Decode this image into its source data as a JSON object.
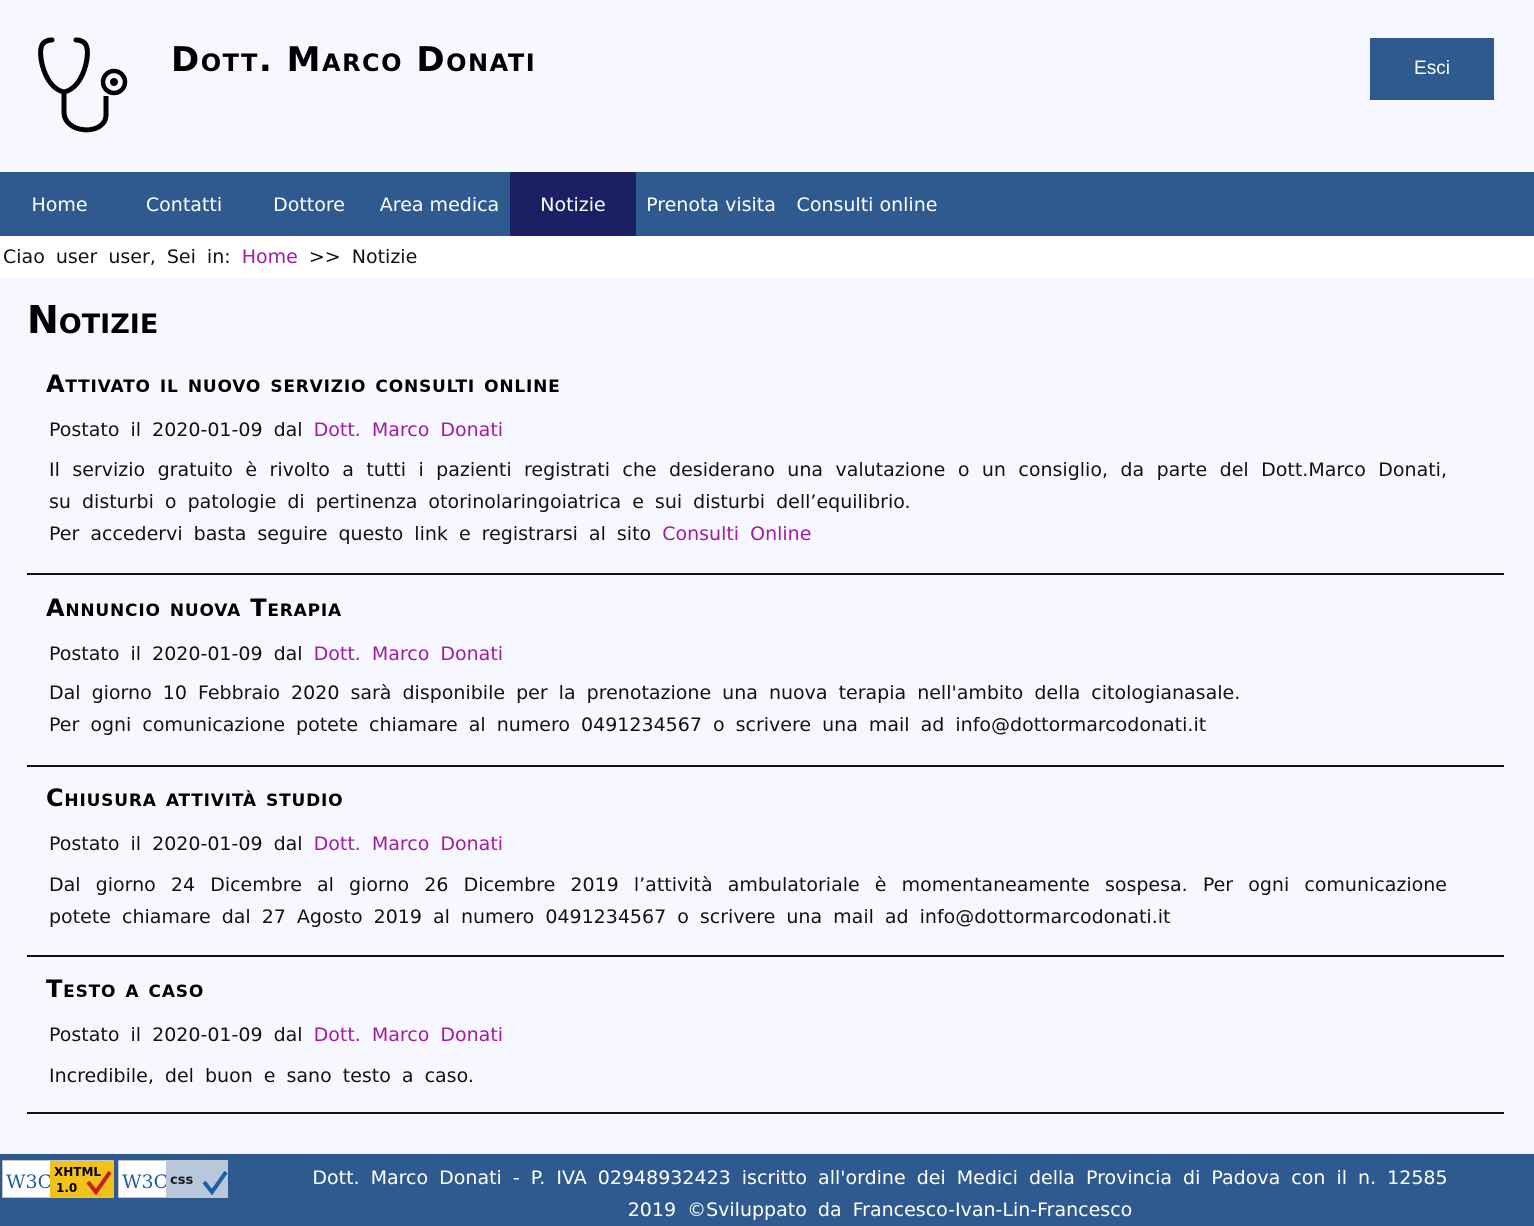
{
  "header": {
    "title": "Dott. Marco Donati",
    "logo_icon": "stethoscope-icon",
    "logout_label": "Esci"
  },
  "nav": {
    "items": [
      {
        "label": "Home"
      },
      {
        "label": "Contatti"
      },
      {
        "label": "Dottore"
      },
      {
        "label": "Area medica"
      },
      {
        "label": "Notizie",
        "active": true
      },
      {
        "label": "Prenota visita"
      },
      {
        "label": "Consulti online"
      }
    ],
    "bg_color": "#2f5a90",
    "active_color": "#1b2064"
  },
  "breadcrumb": {
    "greeting": "Ciao user user, Sei in:",
    "home_link": "Home",
    "separator": ">>",
    "current": "Notizie"
  },
  "page": {
    "heading": "Notizie"
  },
  "news": [
    {
      "title": "Attivato il nuovo servizio consulti online",
      "meta_prefix": "Postato il 2020-01-09 dal",
      "author": "Dott. Marco Donati",
      "body_1": "Il servizio gratuito è rivolto a tutti i pazienti registrati che desiderano una valutazione o un consiglio, da parte del Dott.Marco Donati, su disturbi o patologie di pertinenza otorinolaringoiatrica e sui disturbi dell’equilibrio.",
      "body_2": "Per accedervi basta seguire questo link e registrarsi al sito",
      "body_link": "Consulti Online"
    },
    {
      "title": "Annuncio nuova Terapia",
      "meta_prefix": "Postato il 2020-01-09 dal",
      "author": "Dott. Marco Donati",
      "body_1": "Dal giorno 10 Febbraio 2020 sarà disponibile per la prenotazione una nuova terapia nell'ambito della citologianasale.",
      "body_2": "Per ogni comunicazione potete chiamare al numero 0491234567 o scrivere una mail ad info@dottormarcodonati.it"
    },
    {
      "title": "Chiusura attività studio",
      "meta_prefix": "Postato il 2020-01-09 dal",
      "author": "Dott. Marco Donati",
      "body_1": "Dal giorno 24 Dicembre al giorno 26 Dicembre 2019 l’attività ambulatoriale è momentaneamente sospesa. Per ogni comunicazione potete chiamare dal 27 Agosto 2019 al numero 0491234567 o scrivere una mail ad info@dottormarcodonati.it"
    },
    {
      "title": "Testo a caso",
      "meta_prefix": "Postato il 2020-01-09 dal",
      "author": "Dott. Marco Donati",
      "body_1": "Incredibile, del buon e sano testo a caso."
    }
  ],
  "footer": {
    "line_1": "Dott. Marco Donati - P. IVA 02948932423 iscritto all'ordine dei Medici della Provincia di Padova con il n. 12585",
    "line_2": "2019 ©Sviluppato da Francesco-Ivan-Lin-Francesco",
    "badge_xhtml": {
      "w3c": "W3C",
      "label": "XHTML",
      "version": "1.0"
    },
    "badge_css": {
      "w3c": "W3C",
      "label": "css"
    }
  },
  "colors": {
    "link": "#a31aa3",
    "background": "#f7f8ff"
  }
}
